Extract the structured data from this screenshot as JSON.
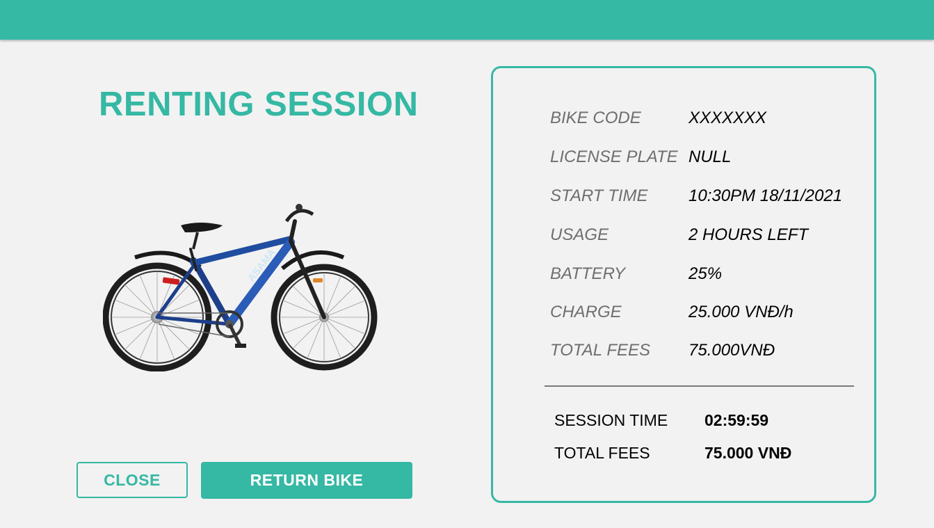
{
  "header": {
    "color": "#35b8a4"
  },
  "page": {
    "title": "RENTING SESSION"
  },
  "bike_image": {
    "icon": "bicycle-image",
    "brand_text": "ASAMA"
  },
  "buttons": {
    "close": "CLOSE",
    "return_bike": "RETURN BIKE"
  },
  "details": [
    {
      "label": "BIKE CODE",
      "value": "XXXXXXX"
    },
    {
      "label": "LICENSE PLATE",
      "value": "NULL"
    },
    {
      "label": "START TIME",
      "value": "10:30PM 18/11/2021"
    },
    {
      "label": "USAGE",
      "value": "2 HOURS LEFT"
    },
    {
      "label": "BATTERY",
      "value": "25%"
    },
    {
      "label": "CHARGE",
      "value": "25.000 VNĐ/h"
    },
    {
      "label": "TOTAL FEES",
      "value": "75.000VNĐ"
    }
  ],
  "summary": {
    "session_time_label": "SESSION TIME",
    "session_time_value": "02:59:59",
    "total_fees_label": "TOTAL FEES",
    "total_fees_value": "75.000 VNĐ"
  },
  "colors": {
    "accent": "#35b8a4",
    "background": "#f2f2f2"
  }
}
